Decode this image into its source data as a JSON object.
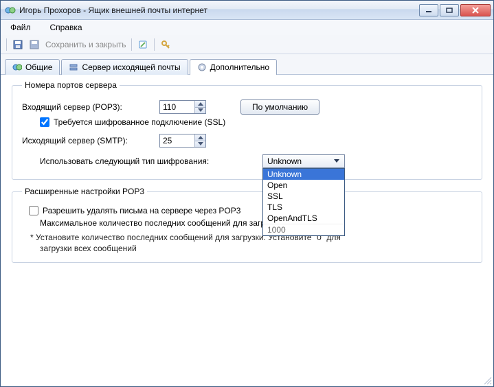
{
  "title": "Игорь Прохоров - Ящик внешней почты интернет",
  "menu": {
    "file": "Файл",
    "help": "Справка"
  },
  "toolbar": {
    "save_close": "Сохранить и закрыть"
  },
  "tabs": {
    "general": "Общие",
    "outgoing": "Сервер исходящей почты",
    "advanced": "Дополнительно"
  },
  "ports_group": {
    "legend": "Номера портов сервера",
    "pop3_label": "Входящий сервер (POP3):",
    "pop3_value": "110",
    "ssl_required": "Требуется шифрованное подключение (SSL)",
    "smtp_label": "Исходящий сервер (SMTP):",
    "smtp_value": "25",
    "enc_type_label": "Использовать следующий тип шифрования:",
    "default_btn": "По умолчанию",
    "combo_value": "Unknown",
    "combo_options": [
      "Unknown",
      "Open",
      "SSL",
      "TLS",
      "OpenAndTLS"
    ],
    "hidden_value": "1000"
  },
  "adv_group": {
    "legend": "Расширенные настройки POP3",
    "allow_delete": "Разрешить удалять письма на сервере через POP3",
    "max_download_label": "Максимальное количество последних сообщений для загрузки*",
    "hint": "* Установите количество последних сообщений для загрузки.  Установите \"0\" для",
    "hint2": "загрузки всех сообщений"
  }
}
